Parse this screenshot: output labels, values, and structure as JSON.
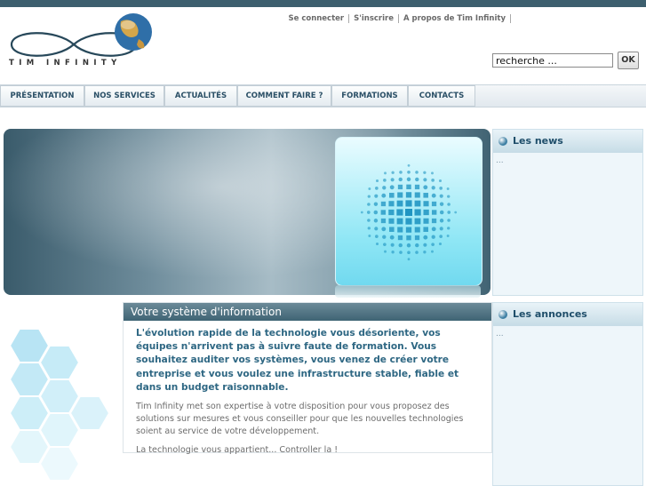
{
  "logo": {
    "text": "TIM INFINITY"
  },
  "top_links": [
    "Se connecter",
    "S'inscrire",
    "A propos de Tim Infinity"
  ],
  "search": {
    "value": "recherche ...",
    "button_label": "OK"
  },
  "nav": [
    "PRÉSENTATION",
    "NOS SERVICES",
    "ACTUALITÉS",
    "COMMENT FAIRE ?",
    "FORMATIONS",
    "CONTACTS"
  ],
  "news": {
    "title": "Les news",
    "body": "..."
  },
  "announcements": {
    "title": "Les annonces",
    "body": "..."
  },
  "main": {
    "title": "Votre système d'information",
    "lead": "L'évolution rapide de la technologie vous désoriente, vos équipes n'arrivent pas à suivre faute de formation. Vous souhaitez auditer vos systèmes, vous venez de créer votre entreprise et vous voulez une infrastructure stable, fiable et dans un budget raisonnable.",
    "paragraph": "Tim Infinity met son expertise à votre disposition pour vous proposez des solutions sur mesures et vous conseiller pour que les nouvelles technologies soient au service de votre développement.",
    "closing": "La technologie vous appartient... Controller la !"
  },
  "colors": {
    "accent": "#2e6783",
    "header_bar": "#3d5f6e",
    "nav_text": "#2a4f66"
  }
}
